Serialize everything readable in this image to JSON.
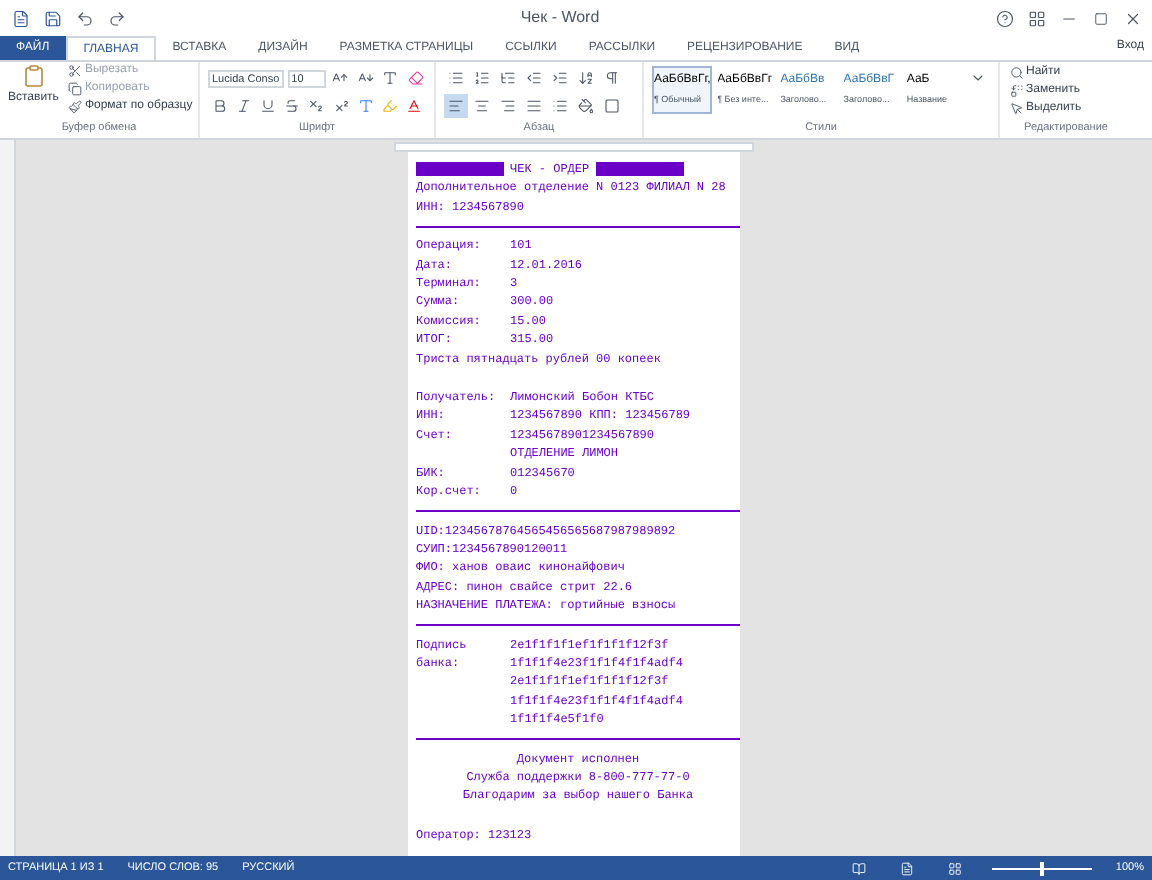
{
  "window": {
    "title": "Чек - Word",
    "sign_in": "Вход"
  },
  "tabs": [
    {
      "label": "ФАЙЛ",
      "kind": "file",
      "selected": false
    },
    {
      "label": "ГЛАВНАЯ",
      "kind": "tab",
      "selected": true
    },
    {
      "label": "ВСТАВКА",
      "kind": "tab",
      "selected": false
    },
    {
      "label": "ДИЗАЙН",
      "kind": "tab",
      "selected": false
    },
    {
      "label": "РАЗМЕТКА СТРАНИЦЫ",
      "kind": "tab",
      "selected": false
    },
    {
      "label": "ССЫЛКИ",
      "kind": "tab",
      "selected": false
    },
    {
      "label": "РАССЫЛКИ",
      "kind": "tab",
      "selected": false
    },
    {
      "label": "РЕЦЕНЗИРОВАНИЕ",
      "kind": "tab",
      "selected": false
    },
    {
      "label": "ВИД",
      "kind": "tab",
      "selected": false
    }
  ],
  "clipboard": {
    "paste": "Вставить",
    "cut": "Вырезать",
    "copy": "Копировать",
    "format_painter": "Формат по образцу",
    "group": "Буфер обмена"
  },
  "font": {
    "name": "Lucida Conso",
    "size": "10",
    "group": "Шрифт"
  },
  "paragraph": {
    "group": "Абзац"
  },
  "styles": {
    "group": "Стили",
    "items": [
      {
        "preview": "АаБбВвГг,",
        "name": "¶ Обычный",
        "selected": true
      },
      {
        "preview": "АаБбВвГг",
        "name": "¶ Без инте...",
        "selected": false
      },
      {
        "preview": "АаБбВв",
        "name": "Заголово...",
        "selected": false
      },
      {
        "preview": "АаБбВвГ",
        "name": "Заголово...",
        "selected": false
      },
      {
        "preview": "АаБ",
        "name": "Название",
        "selected": false
      }
    ]
  },
  "editing": {
    "group": "Редактирование",
    "find": "Найти",
    "replace": "Заменить",
    "select": "Выделить"
  },
  "receipt": [
    {
      "kind": "header",
      "text": "ЧЕК - ОРДЕР"
    },
    {
      "kind": "text",
      "text": "Дополнительное отделение N 0123 ФИЛИАЛ N 28"
    },
    {
      "kind": "text",
      "text": "ИНН: 1234567890"
    },
    {
      "kind": "rule"
    },
    {
      "kind": "field",
      "label": "Операция:",
      "value": "101"
    },
    {
      "kind": "field",
      "label": "Дата:",
      "value": "12.01.2016"
    },
    {
      "kind": "field",
      "label": "Терминал:",
      "value": "3"
    },
    {
      "kind": "field",
      "label": "Сумма:",
      "value": "300.00"
    },
    {
      "kind": "field",
      "label": "Комиссия:",
      "value": "15.00"
    },
    {
      "kind": "field",
      "label": "ИТОГ:",
      "value": "315.00"
    },
    {
      "kind": "text",
      "text": "Триста пятнадцать рублей 00 копеек"
    },
    {
      "kind": "gap"
    },
    {
      "kind": "field",
      "label": "Получатель:",
      "value": "Лимонский Бобон КТБС"
    },
    {
      "kind": "field",
      "label": "ИНН:",
      "value": "1234567890 КПП: 123456789"
    },
    {
      "kind": "field",
      "label": "Счет:",
      "value": "12345678901234567890"
    },
    {
      "kind": "field",
      "value": "ОТДЕЛЕНИЕ ЛИМОН"
    },
    {
      "kind": "field",
      "label": "БИК:",
      "value": "012345670"
    },
    {
      "kind": "field",
      "label": "Кор.счет:",
      "value": "0"
    },
    {
      "kind": "rule"
    },
    {
      "kind": "text",
      "text": "UID:12345678764565456565687987989892"
    },
    {
      "kind": "text",
      "text": "СУИП:1234567890120011"
    },
    {
      "kind": "text",
      "text": "ФИО: ханов оваис кинонайфович"
    },
    {
      "kind": "text",
      "text": "АДРЕС: пинон свайсе стрит 22.6"
    },
    {
      "kind": "text",
      "text": "НАЗНАЧЕНИЕ ПЛАТЕЖА: гортийные взносы"
    },
    {
      "kind": "rule"
    },
    {
      "kind": "field",
      "label": "Подпись",
      "value": "2e1f1f1f1ef1f1f1f12f3f"
    },
    {
      "kind": "field",
      "label": "банка:",
      "value": "1f1f1f4e23f1f1f4f1f4adf4"
    },
    {
      "kind": "field",
      "value": "2e1f1f1f1ef1f1f1f12f3f"
    },
    {
      "kind": "field",
      "value": "1f1f1f4e23f1f1f4f1f4adf4"
    },
    {
      "kind": "field",
      "value": "1f1f1f4e5f1f0"
    },
    {
      "kind": "rule"
    },
    {
      "kind": "center",
      "text": "Документ исполнен"
    },
    {
      "kind": "center",
      "text": "Служба поддержки 8-800-777-77-0"
    },
    {
      "kind": "center",
      "text": "Благодарим за выбор нашего Банка"
    },
    {
      "kind": "gap"
    },
    {
      "kind": "text",
      "text": "Оператор: 123123"
    }
  ],
  "status_bar": {
    "page": "СТРАНИЦА 1 ИЗ 1",
    "words": "ЧИСЛО СЛОВ: 95",
    "language": "РУССКИЙ",
    "zoom": "100%",
    "level": 0.5
  }
}
